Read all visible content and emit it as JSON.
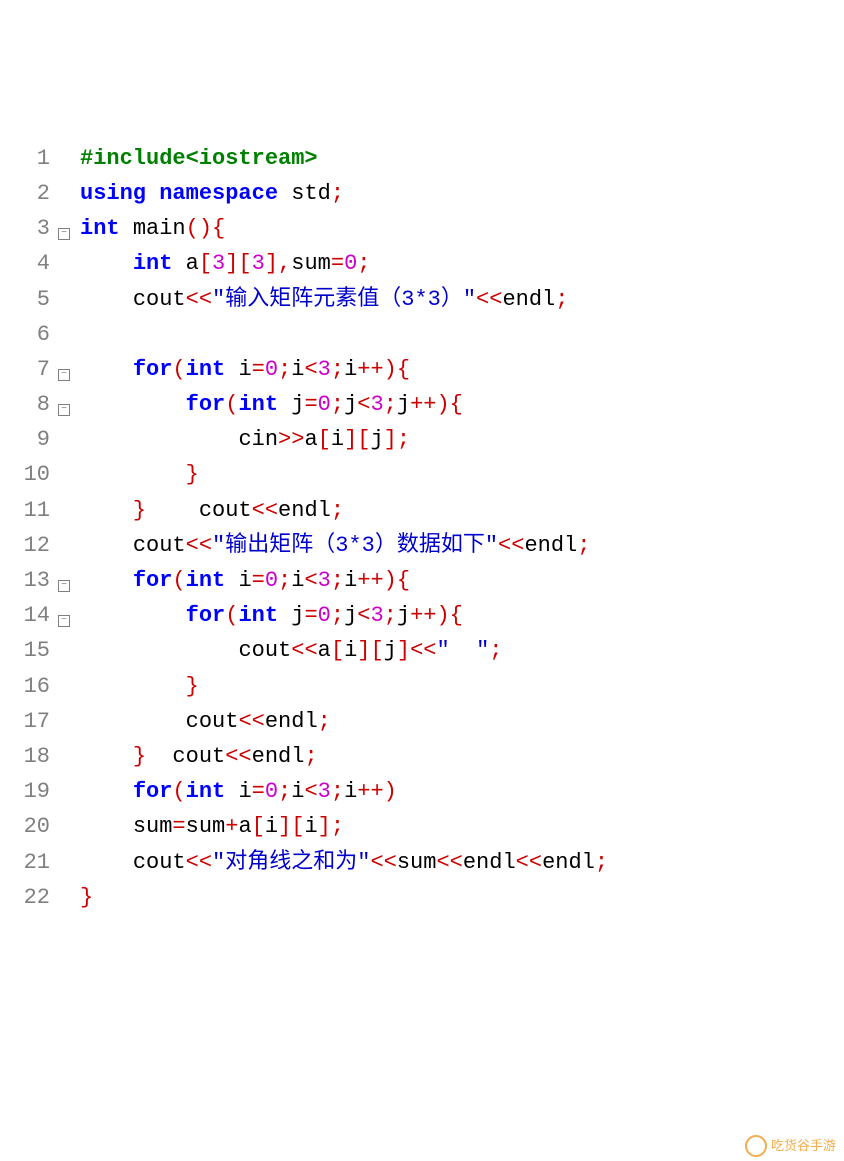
{
  "watermark": "吃货谷手游",
  "lines": [
    {
      "n": 1,
      "fold": "",
      "tokens": [
        [
          "pre",
          "#include<iostream>"
        ]
      ]
    },
    {
      "n": 2,
      "fold": "",
      "tokens": [
        [
          "kw",
          "using"
        ],
        [
          "sym",
          " "
        ],
        [
          "kw",
          "namespace"
        ],
        [
          "sym",
          " "
        ],
        [
          "id",
          "std"
        ],
        [
          "op",
          ";"
        ]
      ]
    },
    {
      "n": 3,
      "fold": "open",
      "tokens": [
        [
          "kw",
          "int"
        ],
        [
          "sym",
          " "
        ],
        [
          "fn",
          "main"
        ],
        [
          "op",
          "(){"
        ]
      ]
    },
    {
      "n": 4,
      "fold": "",
      "tokens": [
        [
          "sym",
          "    "
        ],
        [
          "kw",
          "int"
        ],
        [
          "sym",
          " "
        ],
        [
          "id",
          "a"
        ],
        [
          "op",
          "["
        ],
        [
          "num",
          "3"
        ],
        [
          "op",
          "]["
        ],
        [
          "num",
          "3"
        ],
        [
          "op",
          "],"
        ],
        [
          "id",
          "sum"
        ],
        [
          "op",
          "="
        ],
        [
          "num",
          "0"
        ],
        [
          "op",
          ";"
        ]
      ]
    },
    {
      "n": 5,
      "fold": "",
      "tokens": [
        [
          "sym",
          "    "
        ],
        [
          "id",
          "cout"
        ],
        [
          "op",
          "<<"
        ],
        [
          "str",
          "\"输入矩阵元素值（3*3）\""
        ],
        [
          "op",
          "<<"
        ],
        [
          "id",
          "endl"
        ],
        [
          "op",
          ";"
        ]
      ]
    },
    {
      "n": 6,
      "fold": "",
      "tokens": [
        [
          "sym",
          " "
        ]
      ]
    },
    {
      "n": 7,
      "fold": "open",
      "tokens": [
        [
          "sym",
          "    "
        ],
        [
          "kw",
          "for"
        ],
        [
          "op",
          "("
        ],
        [
          "kw",
          "int"
        ],
        [
          "sym",
          " "
        ],
        [
          "id",
          "i"
        ],
        [
          "op",
          "="
        ],
        [
          "num",
          "0"
        ],
        [
          "op",
          ";"
        ],
        [
          "id",
          "i"
        ],
        [
          "op",
          "<"
        ],
        [
          "num",
          "3"
        ],
        [
          "op",
          ";"
        ],
        [
          "id",
          "i"
        ],
        [
          "op",
          "++){"
        ]
      ]
    },
    {
      "n": 8,
      "fold": "open",
      "tokens": [
        [
          "sym",
          "        "
        ],
        [
          "kw",
          "for"
        ],
        [
          "op",
          "("
        ],
        [
          "kw",
          "int"
        ],
        [
          "sym",
          " "
        ],
        [
          "id",
          "j"
        ],
        [
          "op",
          "="
        ],
        [
          "num",
          "0"
        ],
        [
          "op",
          ";"
        ],
        [
          "id",
          "j"
        ],
        [
          "op",
          "<"
        ],
        [
          "num",
          "3"
        ],
        [
          "op",
          ";"
        ],
        [
          "id",
          "j"
        ],
        [
          "op",
          "++){"
        ]
      ]
    },
    {
      "n": 9,
      "fold": "",
      "tokens": [
        [
          "sym",
          "            "
        ],
        [
          "id",
          "cin"
        ],
        [
          "op",
          ">>"
        ],
        [
          "id",
          "a"
        ],
        [
          "op",
          "["
        ],
        [
          "id",
          "i"
        ],
        [
          "op",
          "]["
        ],
        [
          "id",
          "j"
        ],
        [
          "op",
          "];"
        ]
      ]
    },
    {
      "n": 10,
      "fold": "",
      "tokens": [
        [
          "sym",
          "        "
        ],
        [
          "op",
          "}"
        ]
      ]
    },
    {
      "n": 11,
      "fold": "",
      "tokens": [
        [
          "sym",
          "    "
        ],
        [
          "op",
          "}"
        ],
        [
          "sym",
          "    "
        ],
        [
          "id",
          "cout"
        ],
        [
          "op",
          "<<"
        ],
        [
          "id",
          "endl"
        ],
        [
          "op",
          ";"
        ]
      ]
    },
    {
      "n": 12,
      "fold": "",
      "tokens": [
        [
          "sym",
          "    "
        ],
        [
          "id",
          "cout"
        ],
        [
          "op",
          "<<"
        ],
        [
          "str",
          "\"输出矩阵（3*3）数据如下\""
        ],
        [
          "op",
          "<<"
        ],
        [
          "id",
          "endl"
        ],
        [
          "op",
          ";"
        ]
      ]
    },
    {
      "n": 13,
      "fold": "open",
      "tokens": [
        [
          "sym",
          "    "
        ],
        [
          "kw",
          "for"
        ],
        [
          "op",
          "("
        ],
        [
          "kw",
          "int"
        ],
        [
          "sym",
          " "
        ],
        [
          "id",
          "i"
        ],
        [
          "op",
          "="
        ],
        [
          "num",
          "0"
        ],
        [
          "op",
          ";"
        ],
        [
          "id",
          "i"
        ],
        [
          "op",
          "<"
        ],
        [
          "num",
          "3"
        ],
        [
          "op",
          ";"
        ],
        [
          "id",
          "i"
        ],
        [
          "op",
          "++){"
        ]
      ]
    },
    {
      "n": 14,
      "fold": "open",
      "tokens": [
        [
          "sym",
          "        "
        ],
        [
          "kw",
          "for"
        ],
        [
          "op",
          "("
        ],
        [
          "kw",
          "int"
        ],
        [
          "sym",
          " "
        ],
        [
          "id",
          "j"
        ],
        [
          "op",
          "="
        ],
        [
          "num",
          "0"
        ],
        [
          "op",
          ";"
        ],
        [
          "id",
          "j"
        ],
        [
          "op",
          "<"
        ],
        [
          "num",
          "3"
        ],
        [
          "op",
          ";"
        ],
        [
          "id",
          "j"
        ],
        [
          "op",
          "++){"
        ]
      ]
    },
    {
      "n": 15,
      "fold": "",
      "tokens": [
        [
          "sym",
          "            "
        ],
        [
          "id",
          "cout"
        ],
        [
          "op",
          "<<"
        ],
        [
          "id",
          "a"
        ],
        [
          "op",
          "["
        ],
        [
          "id",
          "i"
        ],
        [
          "op",
          "]["
        ],
        [
          "id",
          "j"
        ],
        [
          "op",
          "]<<"
        ],
        [
          "str",
          "\"  \""
        ],
        [
          "op",
          ";"
        ]
      ]
    },
    {
      "n": 16,
      "fold": "",
      "tokens": [
        [
          "sym",
          "        "
        ],
        [
          "op",
          "}"
        ]
      ]
    },
    {
      "n": 17,
      "fold": "",
      "tokens": [
        [
          "sym",
          "        "
        ],
        [
          "id",
          "cout"
        ],
        [
          "op",
          "<<"
        ],
        [
          "id",
          "endl"
        ],
        [
          "op",
          ";"
        ]
      ]
    },
    {
      "n": 18,
      "fold": "",
      "tokens": [
        [
          "sym",
          "    "
        ],
        [
          "op",
          "}"
        ],
        [
          "sym",
          "  "
        ],
        [
          "id",
          "cout"
        ],
        [
          "op",
          "<<"
        ],
        [
          "id",
          "endl"
        ],
        [
          "op",
          ";"
        ]
      ]
    },
    {
      "n": 19,
      "fold": "",
      "tokens": [
        [
          "sym",
          "    "
        ],
        [
          "kw",
          "for"
        ],
        [
          "op",
          "("
        ],
        [
          "kw",
          "int"
        ],
        [
          "sym",
          " "
        ],
        [
          "id",
          "i"
        ],
        [
          "op",
          "="
        ],
        [
          "num",
          "0"
        ],
        [
          "op",
          ";"
        ],
        [
          "id",
          "i"
        ],
        [
          "op",
          "<"
        ],
        [
          "num",
          "3"
        ],
        [
          "op",
          ";"
        ],
        [
          "id",
          "i"
        ],
        [
          "op",
          "++)"
        ]
      ]
    },
    {
      "n": 20,
      "fold": "",
      "tokens": [
        [
          "sym",
          "    "
        ],
        [
          "id",
          "sum"
        ],
        [
          "op",
          "="
        ],
        [
          "id",
          "sum"
        ],
        [
          "op",
          "+"
        ],
        [
          "id",
          "a"
        ],
        [
          "op",
          "["
        ],
        [
          "id",
          "i"
        ],
        [
          "op",
          "]["
        ],
        [
          "id",
          "i"
        ],
        [
          "op",
          "];"
        ]
      ]
    },
    {
      "n": 21,
      "fold": "",
      "tokens": [
        [
          "sym",
          "    "
        ],
        [
          "id",
          "cout"
        ],
        [
          "op",
          "<<"
        ],
        [
          "str",
          "\"对角线之和为\""
        ],
        [
          "op",
          "<<"
        ],
        [
          "id",
          "sum"
        ],
        [
          "op",
          "<<"
        ],
        [
          "id",
          "endl"
        ],
        [
          "op",
          "<<"
        ],
        [
          "id",
          "endl"
        ],
        [
          "op",
          ";"
        ]
      ]
    },
    {
      "n": 22,
      "fold": "",
      "tokens": [
        [
          "op",
          "}"
        ]
      ]
    }
  ]
}
